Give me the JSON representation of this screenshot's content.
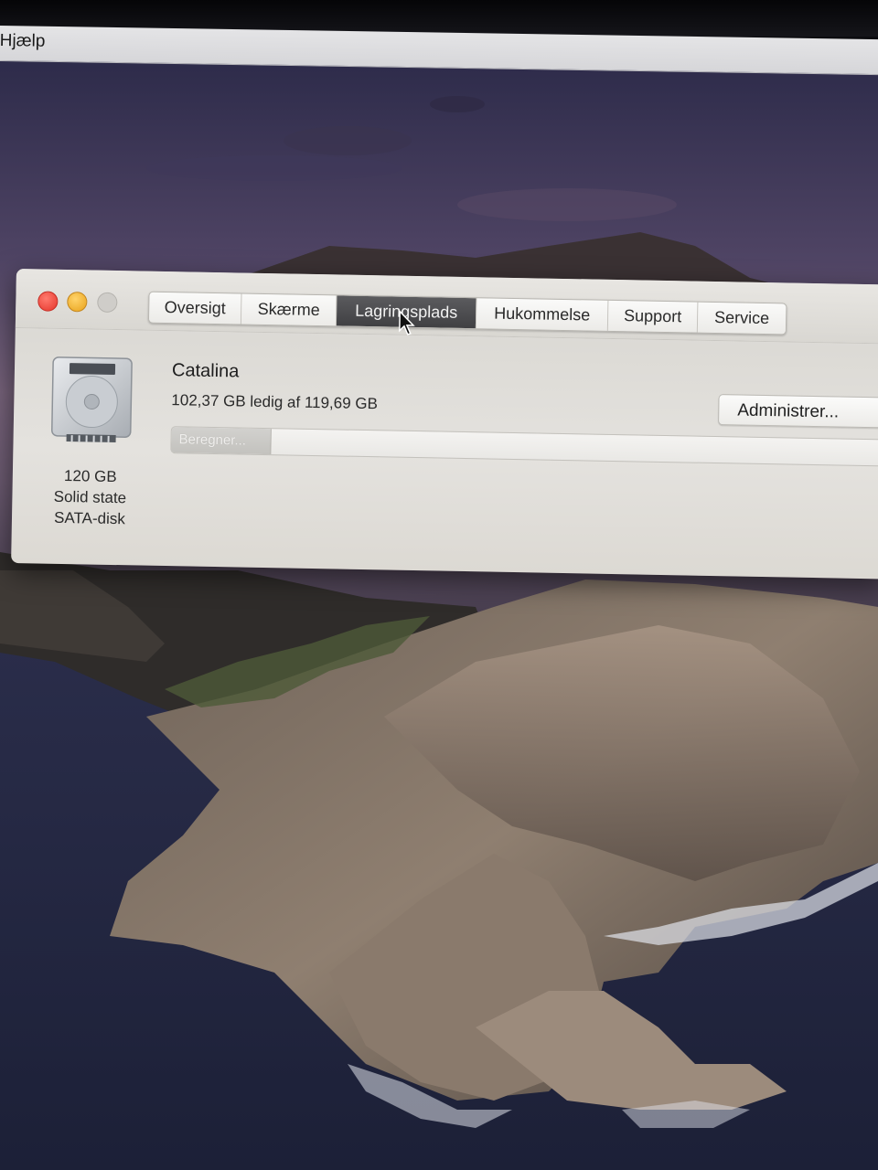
{
  "menubar": {
    "help_label": "Hjælp"
  },
  "window": {
    "tabs": [
      {
        "label": "Oversigt",
        "active": false
      },
      {
        "label": "Skærme",
        "active": false
      },
      {
        "label": "Lagringsplads",
        "active": true
      },
      {
        "label": "Hukommelse",
        "active": false
      },
      {
        "label": "Support",
        "active": false
      },
      {
        "label": "Service",
        "active": false
      }
    ],
    "disk": {
      "icon": "hard-drive-icon",
      "size": "120 GB",
      "type_line1": "Solid state",
      "type_line2": "SATA-disk"
    },
    "volume": {
      "name": "Catalina",
      "space": "102,37 GB ledig af 119,69 GB",
      "bar_status": "Beregner...",
      "progress_fraction": 0.14
    },
    "manage_button": "Administrer..."
  },
  "colors": {
    "close": "#e5352b",
    "minimize": "#e8a21b",
    "active_tab": "#404043"
  }
}
